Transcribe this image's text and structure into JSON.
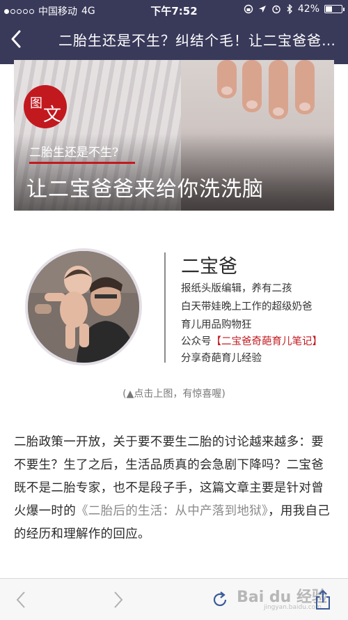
{
  "status_bar": {
    "carrier": "中国移动",
    "network": "4G",
    "time": "下午7:52",
    "battery": "42%",
    "battery_level": 0.42
  },
  "nav": {
    "title": "二胎生还是不生？纠结个毛！让二宝爸爸来给你洗洗脑",
    "back_icon": "chevron-left-icon"
  },
  "banner": {
    "badge_char1": "图",
    "badge_char2": "文",
    "subtitle": "二胎生还是不生?",
    "title": "让二宝爸爸来给你洗洗脑",
    "accent": "#c2191f"
  },
  "profile": {
    "name": "二宝爸",
    "line1": "报纸头版编辑，养有二孩",
    "line2": "白天带娃晚上工作的超级奶爸",
    "line3": "育儿用品购物狂",
    "line4_prefix": "公众号",
    "line4_highlight": "【二宝爸奇葩育儿笔记】",
    "line5": "分享奇葩育儿经验"
  },
  "caption": "(▲点击上图，有惊喜喔)",
  "article": {
    "text_before": "二胎政策一开放，关于要不要生二胎的讨论越来越多：要不要生？生了之后，生活品质真的会急剧下降吗？二宝爸既不是二胎专家，也不是段子手，这篇文章主要是针对曾火爆一时的",
    "quote": "《二胎后的生活：从中产落到地狱》",
    "text_after": "，用我自己的经历和理解作的回应。"
  },
  "toolbar": {
    "back_icon": "arrow-left-icon",
    "forward_icon": "arrow-right-icon",
    "refresh_icon": "refresh-icon",
    "share_icon": "share-icon",
    "watermark": "Bai du 经验",
    "watermark_sub": "jingyan.baidu.com"
  }
}
